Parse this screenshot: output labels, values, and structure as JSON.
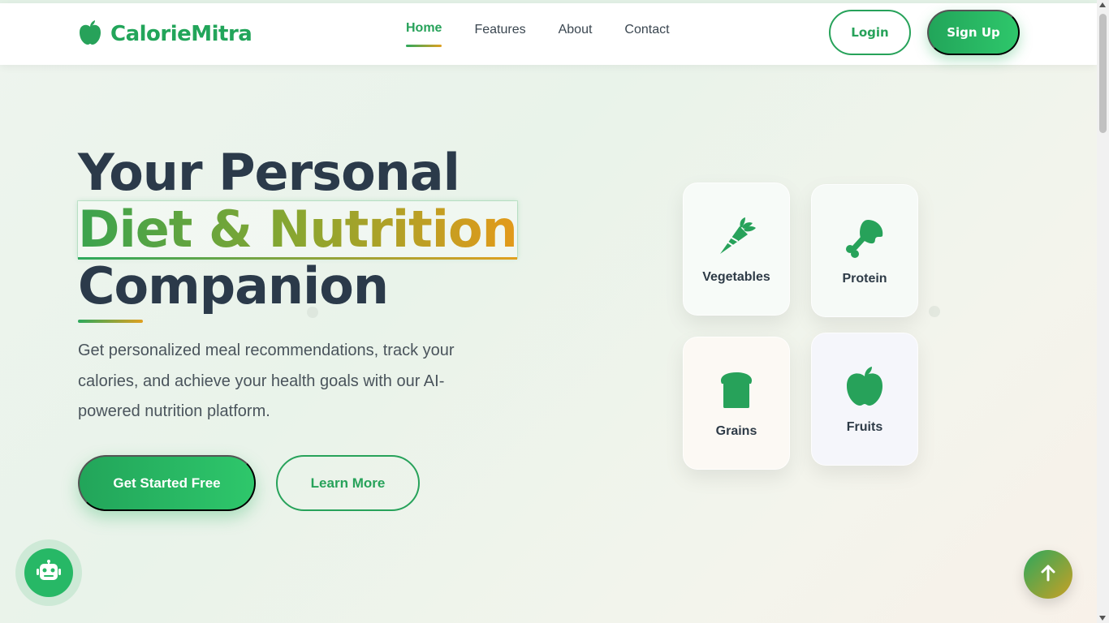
{
  "brand": {
    "name": "CalorieMitra",
    "icon": "apple-icon"
  },
  "nav": {
    "links": [
      {
        "label": "Home",
        "active": true
      },
      {
        "label": "Features",
        "active": false
      },
      {
        "label": "About",
        "active": false
      },
      {
        "label": "Contact",
        "active": false
      }
    ],
    "login_label": "Login",
    "signup_label": "Sign Up"
  },
  "hero": {
    "title_line1": "Your Personal",
    "title_line2": "Diet & Nutrition",
    "title_line3": "Companion",
    "description": "Get personalized meal recommendations, track your calories, and achieve your health goals with our AI-powered nutrition platform.",
    "primary_cta": "Get Started Free",
    "secondary_cta": "Learn More"
  },
  "categories": [
    {
      "label": "Vegetables",
      "icon": "carrot-icon"
    },
    {
      "label": "Protein",
      "icon": "drumstick-icon"
    },
    {
      "label": "Grains",
      "icon": "bread-icon"
    },
    {
      "label": "Fruits",
      "icon": "apple-icon"
    }
  ],
  "widgets": {
    "chatbot_icon": "robot-icon",
    "scroll_top_icon": "arrow-up-icon"
  },
  "colors": {
    "accent": "#27a25a",
    "accent_light": "#2ec76b",
    "gradient_end": "#e0a020",
    "heading": "#2b3a4a"
  }
}
